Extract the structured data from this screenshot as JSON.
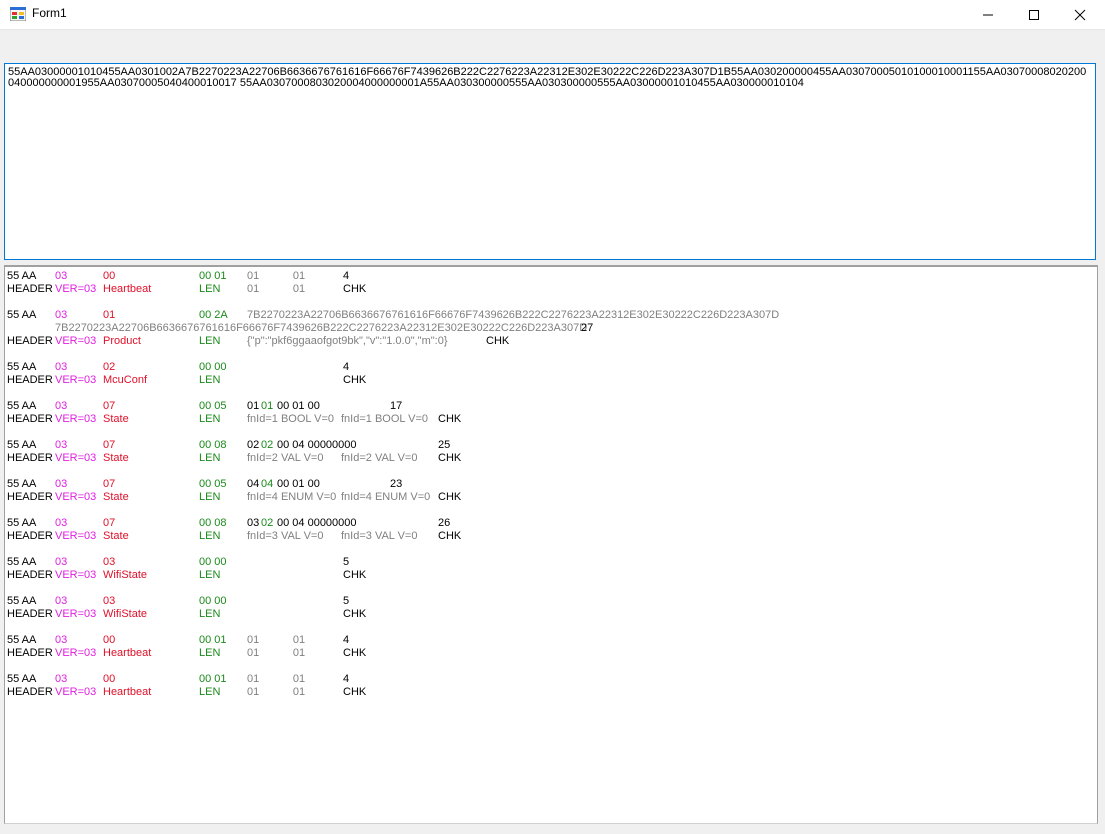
{
  "window": {
    "title": "Form1"
  },
  "input": {
    "text": "55AA03000001010455AA0301002A7B2270223A22706B6636676761616F66676F7439626B222C2276223A22312E302E30222C226D223A307D1B55AA030200000455AA03070005010100010001155AA03070008020200040000000001955AA03070005040400010017 55AA0307000803020004000000001A55AA030300000555AA030300000555AA03000001010455AA030000010104"
  },
  "colors": {
    "header": "#000000",
    "version": "#e020e0",
    "command": "#e0102a",
    "length": "#1a8a1a",
    "payload": "#808080",
    "checksum": "#000000",
    "accent": "#0078d7"
  },
  "packets": [
    {
      "header_bytes": "55 AA",
      "header_label": "HEADER",
      "ver_byte": "03",
      "ver_label": "VER=03",
      "cmd_byte": "00",
      "cmd_name": "Heartbeat",
      "len_bytes": "00 01",
      "len_label": "LEN",
      "payload_top": "01           01",
      "payload_bottom": "01           01",
      "chk_value": "4",
      "chk_label": "CHK"
    },
    {
      "header_bytes": "55 AA",
      "header_label": "HEADER",
      "ver_byte": "03",
      "ver_label": "VER=03",
      "cmd_byte": "01",
      "cmd_name": "Product",
      "len_bytes": "00 2A",
      "len_label": "LEN",
      "payload_top": "7B2270223A22706B6636676761616F66676F7439626B222C2276223A22312E302E30222C226D223A307D",
      "payload_wrap": "7B2270223A22706B6636676761616F66676F7439626B222C2276223A22312E302E30222C226D223A307D",
      "chk_value": "27",
      "payload_bottom": "{\"p\":\"pkf6ggaaofgot9bk\",\"v\":\"1.0.0\",\"m\":0}",
      "chk_label": "CHK"
    },
    {
      "header_bytes": "55 AA",
      "header_label": "HEADER",
      "ver_byte": "03",
      "ver_label": "VER=03",
      "cmd_byte": "02",
      "cmd_name": "McuConf",
      "len_bytes": "00 00",
      "len_label": "LEN",
      "chk_value": "4",
      "chk_label": "CHK"
    },
    {
      "header_bytes": "55 AA",
      "header_label": "HEADER",
      "ver_byte": "03",
      "ver_label": "VER=03",
      "cmd_byte": "07",
      "cmd_name": "State",
      "len_bytes": "00 05",
      "len_label": "LEN",
      "dp_a": "01",
      "dp_b": "01",
      "dp_rest": "00 01 00",
      "dp_desc1": "fnId=1 BOOL V=0",
      "dp_desc2": "fnId=1 BOOL V=0",
      "chk_value": "17",
      "chk_label": "CHK"
    },
    {
      "header_bytes": "55 AA",
      "header_label": "HEADER",
      "ver_byte": "03",
      "ver_label": "VER=03",
      "cmd_byte": "07",
      "cmd_name": "State",
      "len_bytes": "00 08",
      "len_label": "LEN",
      "dp_a": "02",
      "dp_b": "02",
      "dp_rest": "00 04 00000000",
      "dp_desc1": "fnId=2 VAL V=0",
      "dp_desc2": "fnId=2 VAL V=0",
      "chk_value": "25",
      "chk_label": "CHK"
    },
    {
      "header_bytes": "55 AA",
      "header_label": "HEADER",
      "ver_byte": "03",
      "ver_label": "VER=03",
      "cmd_byte": "07",
      "cmd_name": "State",
      "len_bytes": "00 05",
      "len_label": "LEN",
      "dp_a": "04",
      "dp_b": "04",
      "dp_rest": "00 01 00",
      "dp_desc1": "fnId=4 ENUM V=0",
      "dp_desc2": "fnId=4 ENUM V=0",
      "chk_value": "23",
      "chk_label": "CHK"
    },
    {
      "header_bytes": "55 AA",
      "header_label": "HEADER",
      "ver_byte": "03",
      "ver_label": "VER=03",
      "cmd_byte": "07",
      "cmd_name": "State",
      "len_bytes": "00 08",
      "len_label": "LEN",
      "dp_a": "03",
      "dp_b": "02",
      "dp_rest": "00 04 00000000",
      "dp_desc1": "fnId=3 VAL V=0",
      "dp_desc2": "fnId=3 VAL V=0",
      "chk_value": "26",
      "chk_label": "CHK"
    },
    {
      "header_bytes": "55 AA",
      "header_label": "HEADER",
      "ver_byte": "03",
      "ver_label": "VER=03",
      "cmd_byte": "03",
      "cmd_name": "WifiState",
      "len_bytes": "00 00",
      "len_label": "LEN",
      "chk_value": "5",
      "chk_label": "CHK"
    },
    {
      "header_bytes": "55 AA",
      "header_label": "HEADER",
      "ver_byte": "03",
      "ver_label": "VER=03",
      "cmd_byte": "03",
      "cmd_name": "WifiState",
      "len_bytes": "00 00",
      "len_label": "LEN",
      "chk_value": "5",
      "chk_label": "CHK"
    },
    {
      "header_bytes": "55 AA",
      "header_label": "HEADER",
      "ver_byte": "03",
      "ver_label": "VER=03",
      "cmd_byte": "00",
      "cmd_name": "Heartbeat",
      "len_bytes": "00 01",
      "len_label": "LEN",
      "payload_top": "01           01",
      "payload_bottom": "01           01",
      "chk_value": "4",
      "chk_label": "CHK"
    },
    {
      "header_bytes": "55 AA",
      "header_label": "HEADER",
      "ver_byte": "03",
      "ver_label": "VER=03",
      "cmd_byte": "00",
      "cmd_name": "Heartbeat",
      "len_bytes": "00 01",
      "len_label": "LEN",
      "payload_top": "01           01",
      "payload_bottom": "01           01",
      "chk_value": "4",
      "chk_label": "CHK"
    }
  ]
}
